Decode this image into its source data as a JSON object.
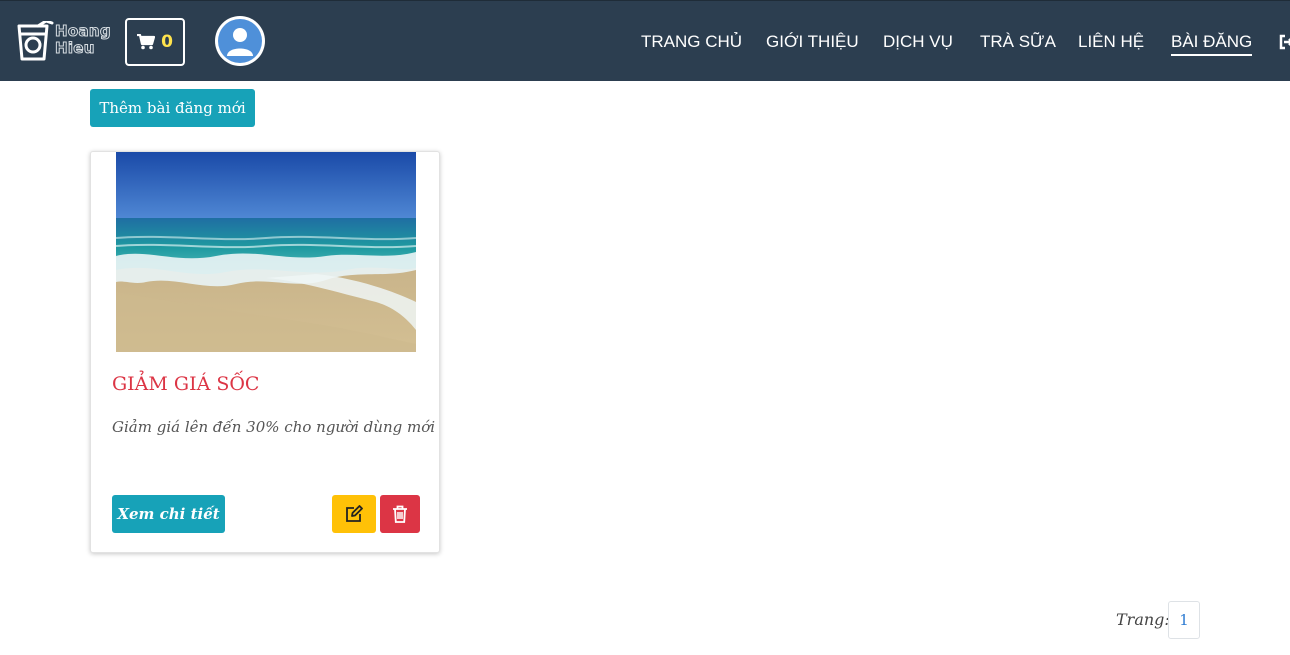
{
  "header": {
    "logo_text": "Hoang Hieu",
    "cart_count": "0",
    "nav": [
      {
        "label": "TRANG CHỦ"
      },
      {
        "label": "GIỚI THIỆU"
      },
      {
        "label": "DỊCH VỤ"
      },
      {
        "label": "TRÀ SỮA"
      },
      {
        "label": "LIÊN HỆ"
      },
      {
        "label": "BÀI ĐĂNG",
        "active": true
      }
    ]
  },
  "main": {
    "add_post_label": "Thêm bài đăng mới",
    "posts": [
      {
        "title": "GIẢM GIÁ SỐC",
        "description": "Giảm giá lên đến 30% cho người dùng mới",
        "detail_label": "Xem chi tiết"
      }
    ]
  },
  "pagination": {
    "label": "Trang:",
    "pages": [
      "1"
    ]
  },
  "colors": {
    "navbar": "#2c3e50",
    "primary": "#17a2b8",
    "warning": "#ffc107",
    "danger": "#dc3545",
    "cart_count": "#ffe34d"
  },
  "icons": [
    "cup-logo-icon",
    "cart-icon",
    "user-icon",
    "sign-out-icon",
    "edit-icon",
    "trash-icon"
  ]
}
